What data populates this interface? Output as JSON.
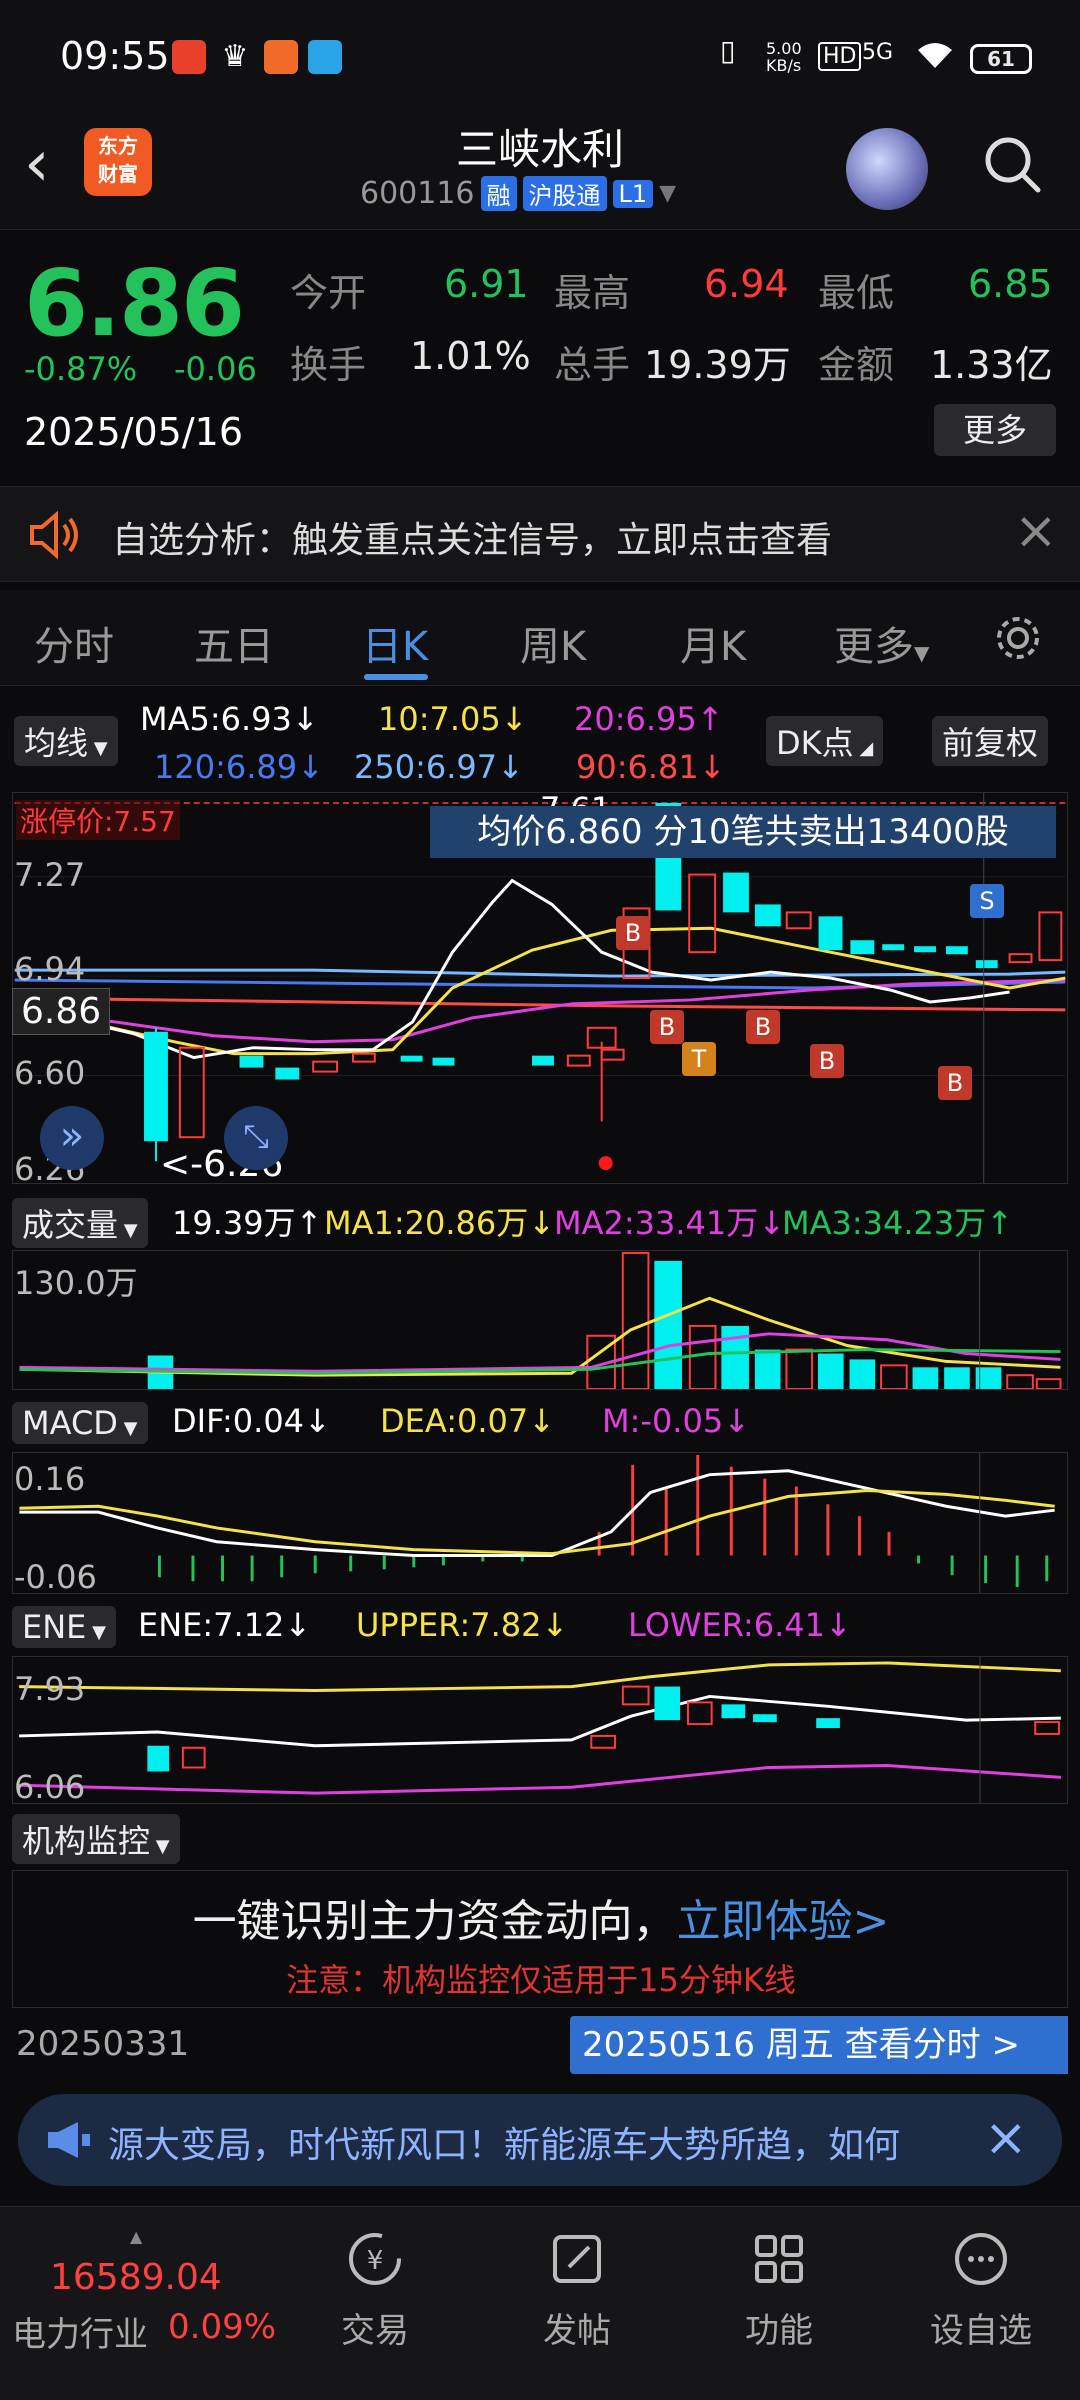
{
  "status": {
    "time": "09:55",
    "speed": "5.00\nKB/s",
    "net": "HD",
    "signal": "5G",
    "battery": "61"
  },
  "header": {
    "title": "三峡水利",
    "code": "600116",
    "tags": [
      "融",
      "沪股通",
      "L1"
    ],
    "logo": "东方\n财富"
  },
  "quote": {
    "price": "6.86",
    "change_pct": "-0.87%",
    "change": "-0.06",
    "date": "2025/05/16",
    "fields": [
      {
        "label": "今开",
        "value": "6.91",
        "color": "#23c25a"
      },
      {
        "label": "最高",
        "value": "6.94",
        "color": "#ff3b3b"
      },
      {
        "label": "最低",
        "value": "6.85",
        "color": "#23c25a"
      },
      {
        "label": "换手",
        "value": "1.01%",
        "color": "#ffffff"
      },
      {
        "label": "总手",
        "value": "19.39万",
        "color": "#ffffff"
      },
      {
        "label": "金额",
        "value": "1.33亿",
        "color": "#ffffff"
      }
    ],
    "more": "更多"
  },
  "notice": {
    "text": "自选分析：触发重点关注信号，立即点击查看"
  },
  "tabs": [
    "分时",
    "五日",
    "日K",
    "周K",
    "月K",
    "更多"
  ],
  "kline": {
    "selector": "均线",
    "ma": [
      {
        "label": "MA5:6.93↓",
        "color": "#ffffff"
      },
      {
        "label": "10:7.05↓",
        "color": "#f5e24a"
      },
      {
        "label": "20:6.95↑",
        "color": "#e040e0"
      },
      {
        "label": "120:6.89↓",
        "color": "#4a7af0"
      },
      {
        "label": "250:6.97↓",
        "color": "#7ab8ff"
      },
      {
        "label": "90:6.81↓",
        "color": "#ff4a4a"
      }
    ],
    "dk_btn": "DK点",
    "fq_btn": "前复权",
    "limit_up": "涨停价:7.57",
    "y_ticks": [
      "7.61",
      "7.27",
      "6.94",
      "6.60",
      "6.26"
    ],
    "high_label": "7.61",
    "low_label": "<-6.26",
    "current_price": "6.86",
    "tooltip": "均价6.860 分10笔共卖出13400股",
    "marks": [
      "B",
      "B",
      "B",
      "T",
      "B",
      "B",
      "S"
    ]
  },
  "volume": {
    "selector": "成交量",
    "value": "19.39万↑",
    "ma1": "MA1:20.86万↓",
    "ma2": "MA2:33.41万↓",
    "ma3": "MA3:34.23万↑",
    "y_tick": "130.0万"
  },
  "macd": {
    "selector": "MACD",
    "dif": "DIF:0.04↓",
    "dea": "DEA:0.07↓",
    "m": "M:-0.05↓",
    "y_top": "0.16",
    "y_bot": "-0.06"
  },
  "ene": {
    "selector": "ENE",
    "ene": "ENE:7.12↓",
    "upper": "UPPER:7.82↓",
    "lower": "LOWER:6.41↓",
    "y_top": "7.93",
    "y_bot": "6.06"
  },
  "monitor": {
    "selector": "机构监控",
    "title_a": "一键识别主力资金动向，",
    "title_b": "立即体验>",
    "note": "注意：机构监控仅适用于15分钟K线"
  },
  "dates": {
    "left": "20250331",
    "right": "20250516 周五 查看分时 >"
  },
  "ticker": {
    "text": "源大变局，时代新风口！新能源车大势所趋，如何"
  },
  "bottom": {
    "index_value": "16589.04",
    "index_name": "电力行业",
    "index_pct": "0.09%",
    "items": [
      "交易",
      "发帖",
      "功能",
      "设自选"
    ]
  }
}
